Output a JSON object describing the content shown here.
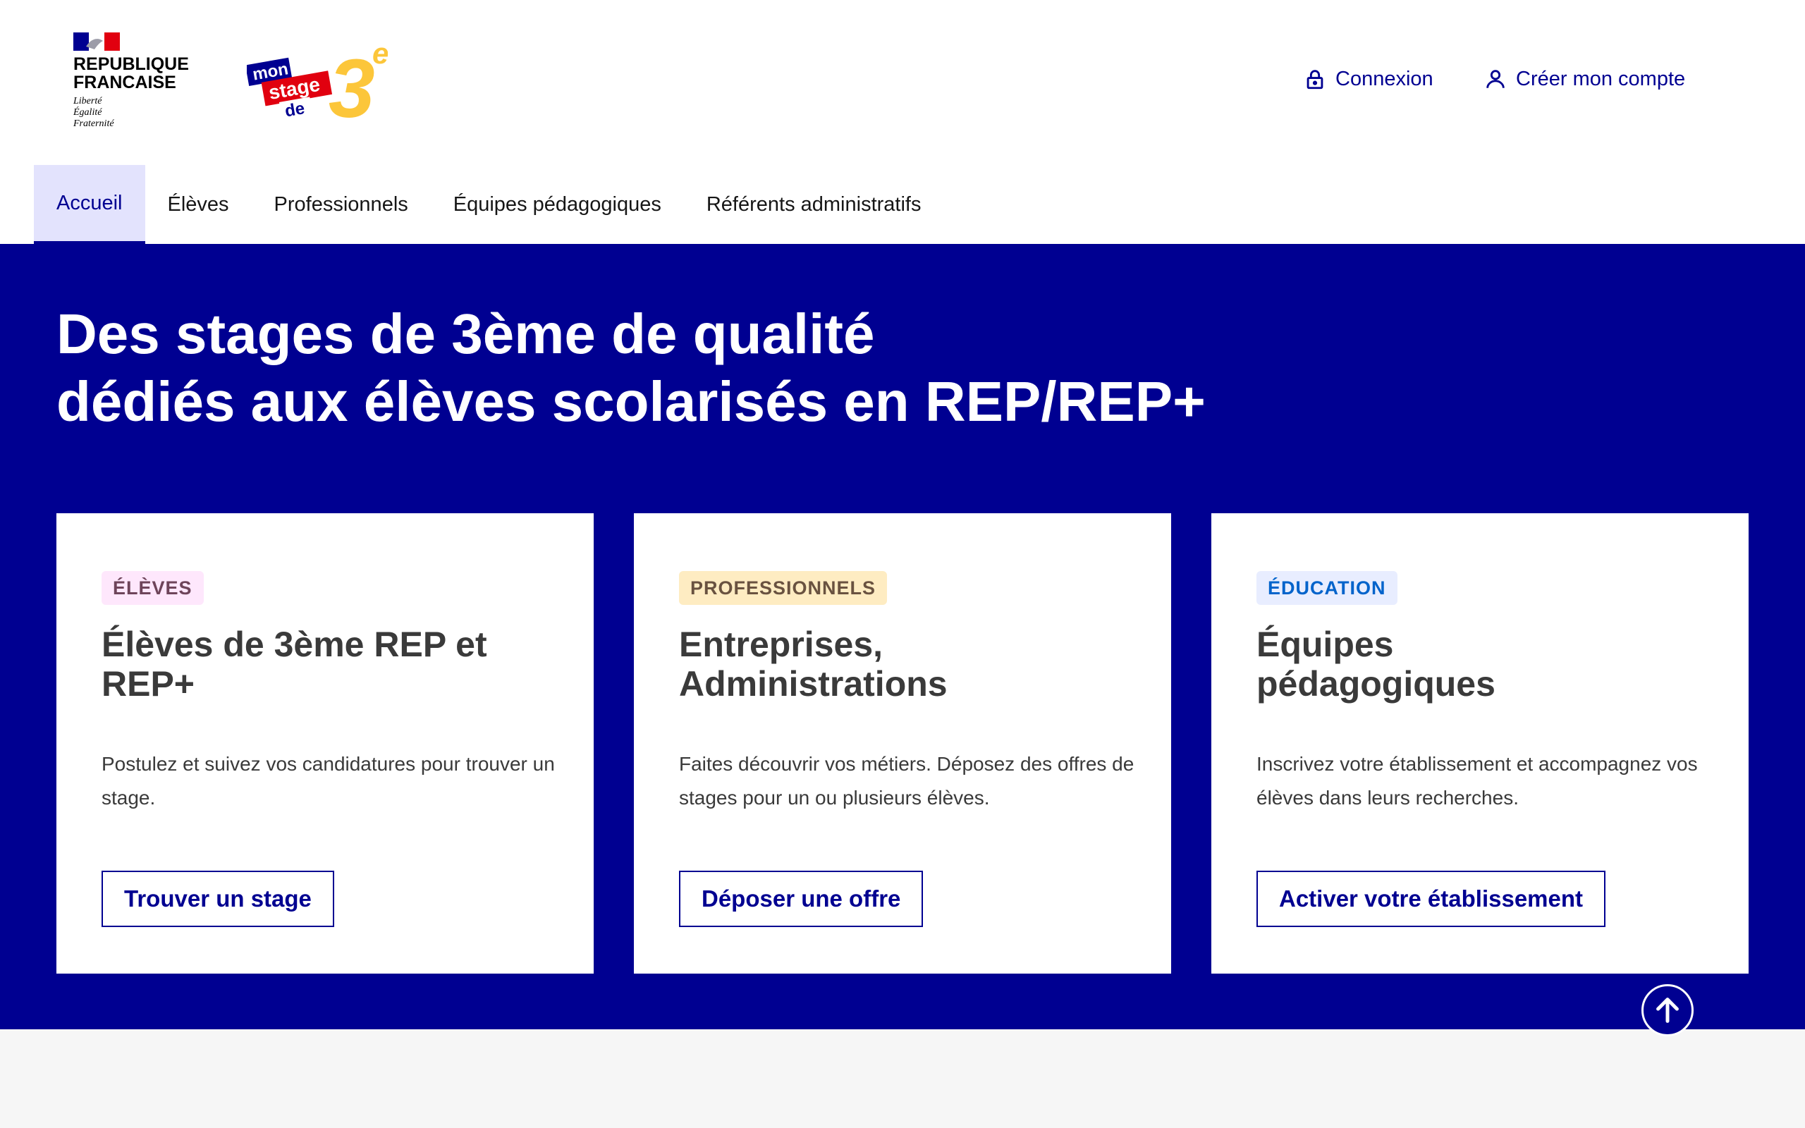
{
  "header": {
    "republic_name": "REPUBLIQUE\nFRANCAISE",
    "motto": "Liberté\nÉgalité\nFraternité",
    "logo_text": {
      "mon": "mon",
      "stage": "stage",
      "de": "de",
      "level": "3",
      "suffix": "e"
    },
    "tools": {
      "login": {
        "label": "Connexion",
        "icon": "lock-icon"
      },
      "signup": {
        "label": "Créer mon compte",
        "icon": "user-icon"
      }
    }
  },
  "nav": {
    "items": [
      {
        "label": "Accueil",
        "active": true
      },
      {
        "label": "Élèves",
        "active": false
      },
      {
        "label": "Professionnels",
        "active": false
      },
      {
        "label": "Équipes pédagogiques",
        "active": false
      },
      {
        "label": "Référents administratifs",
        "active": false
      }
    ]
  },
  "hero": {
    "title": "Des stages de 3ème de qualité\ndédiés aux élèves scolarisés en REP/REP+"
  },
  "cards": [
    {
      "badge": "ÉLÈVES",
      "badge_bg": "#fee7fc",
      "badge_color": "#6e445a",
      "title": "Élèves de 3ème REP et REP+",
      "description": "Postulez et suivez vos candidatures pour trouver un stage.",
      "button": "Trouver un stage"
    },
    {
      "badge": "PROFESSIONNELS",
      "badge_bg": "#feecc2",
      "badge_color": "#695240",
      "title": "Entreprises, Administrations",
      "description": "Faites découvrir vos métiers. Déposez des offres de stages pour un ou plusieurs élèves.",
      "button": "Déposer une offre"
    },
    {
      "badge": "ÉDUCATION",
      "badge_bg": "#e8edff",
      "badge_color": "#0063cb",
      "title": "Équipes pédagogiques",
      "description": "Inscrivez votre établissement et accompagnez vos élèves dans leurs recherches.",
      "button": "Activer votre établissement"
    }
  ],
  "colors": {
    "primary": "#000091",
    "nav_active_bg": "#e3e3fd",
    "marianne_red": "#e1000f",
    "logo_yellow": "#fcc63a"
  },
  "scroll_top_icon": "arrow-up-icon"
}
